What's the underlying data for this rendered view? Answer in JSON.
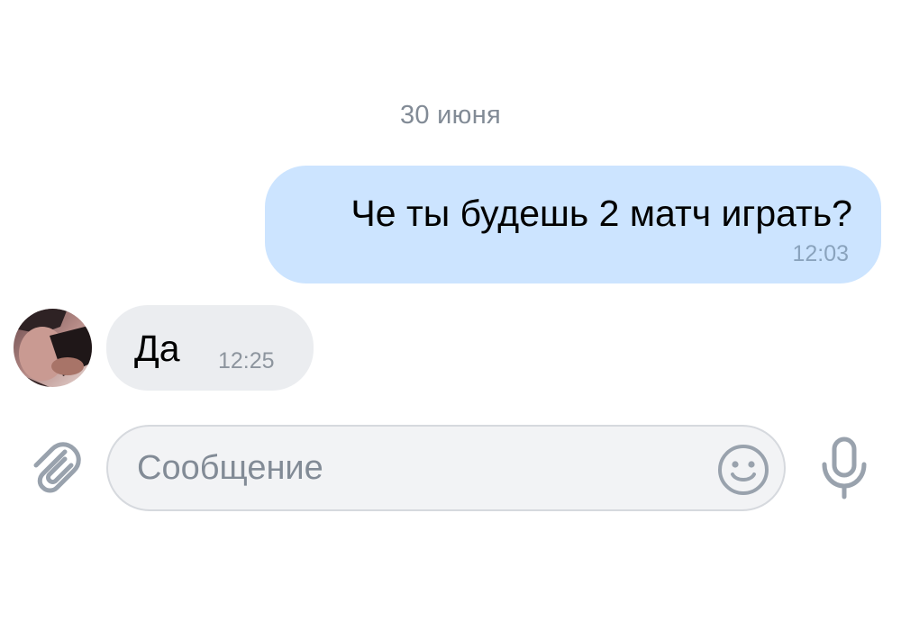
{
  "date_separator": "30 июня",
  "messages": [
    {
      "direction": "outgoing",
      "text": "Че ты будешь 2 матч играть?",
      "time": "12:03"
    },
    {
      "direction": "incoming",
      "text": "Да",
      "time": "12:25"
    }
  ],
  "composer": {
    "placeholder": "Сообщение",
    "value": ""
  },
  "icons": {
    "attach": "paperclip-icon",
    "emoji": "smiley-icon",
    "mic": "microphone-icon"
  },
  "colors": {
    "outgoing_bubble": "#cce4ff",
    "incoming_bubble": "#ebedf0",
    "icon_gray": "#99a2ad",
    "secondary_text": "#828b96"
  }
}
